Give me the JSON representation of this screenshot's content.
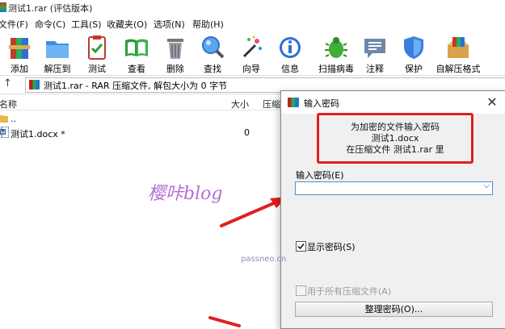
{
  "window": {
    "title": "测试1.rar (评估版本)"
  },
  "menu": [
    "文件(F)",
    "命令(C)",
    "工具(S)",
    "收藏夹(O)",
    "选项(N)",
    "帮助(H)"
  ],
  "toolbar": [
    {
      "label": "添加",
      "icon": "add-icon"
    },
    {
      "label": "解压到",
      "icon": "extract-icon"
    },
    {
      "label": "测试",
      "icon": "test-icon"
    },
    {
      "label": "查看",
      "icon": "view-icon"
    },
    {
      "label": "删除",
      "icon": "delete-icon"
    },
    {
      "label": "查找",
      "icon": "find-icon"
    },
    {
      "label": "向导",
      "icon": "wizard-icon"
    },
    {
      "label": "信息",
      "icon": "info-icon"
    },
    {
      "label": "扫描病毒",
      "icon": "virus-scan-icon"
    },
    {
      "label": "注释",
      "icon": "comment-icon"
    },
    {
      "label": "保护",
      "icon": "protect-icon"
    },
    {
      "label": "自解压格式",
      "icon": "sfx-icon"
    }
  ],
  "address": {
    "text": "测试1.rar - RAR 压缩文件, 解包大小为 0 字节"
  },
  "list": {
    "columns": [
      "名称",
      "大小",
      "压缩"
    ],
    "rows": [
      {
        "name": "..",
        "size": ""
      },
      {
        "name": "测试1.docx *",
        "size": "0"
      }
    ]
  },
  "dialog": {
    "title": "输入密码",
    "info": [
      "为加密的文件输入密码",
      "测试1.docx",
      "在压缩文件 测试1.rar 里"
    ],
    "password_label": "输入密码(E)",
    "password_value": "",
    "show_password_label": "显示密码(S)",
    "show_password_checked": true,
    "apply_all_label": "用于所有压缩文件(A)",
    "apply_all_enabled": false,
    "organize_button": "整理密码(O)..."
  },
  "watermarks": {
    "main": "樱咔blog",
    "site": "passneo.cn"
  },
  "colors": {
    "highlight": "#e02020",
    "watermark": "#b46fd6",
    "input_focus": "#4a8fd6"
  }
}
